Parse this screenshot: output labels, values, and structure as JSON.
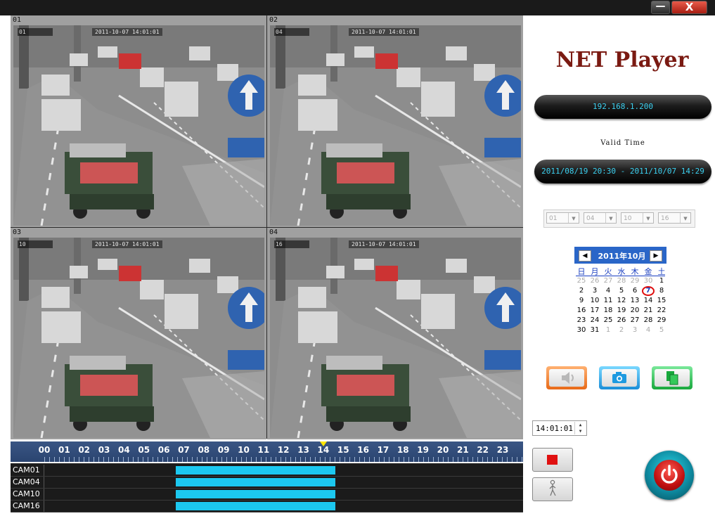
{
  "window": {
    "minimize_label": "—",
    "close_label": "X"
  },
  "video": {
    "channels": [
      {
        "label": "01",
        "osd_id": "01",
        "timestamp": "2011-10-07 14:01:01"
      },
      {
        "label": "02",
        "osd_id": "04",
        "timestamp": "2011-10-07 14:01:01"
      },
      {
        "label": "03",
        "osd_id": "10",
        "timestamp": "2011-10-07 14:01:01"
      },
      {
        "label": "04",
        "osd_id": "16",
        "timestamp": "2011-10-07 14:01:01"
      }
    ]
  },
  "timeline": {
    "hours": [
      "00",
      "01",
      "02",
      "03",
      "04",
      "05",
      "06",
      "07",
      "08",
      "09",
      "10",
      "11",
      "12",
      "13",
      "14",
      "15",
      "16",
      "17",
      "18",
      "19",
      "20",
      "21",
      "22",
      "23"
    ],
    "current_hour": 14,
    "tracks": [
      {
        "label": "CAM01",
        "start_hour": 6.6,
        "end_hour": 14.6
      },
      {
        "label": "CAM04",
        "start_hour": 6.6,
        "end_hour": 14.6
      },
      {
        "label": "CAM10",
        "start_hour": 6.6,
        "end_hour": 14.6
      },
      {
        "label": "CAM16",
        "start_hour": 6.6,
        "end_hour": 14.6
      }
    ],
    "record_color": "#1cc8f0"
  },
  "sidebar": {
    "title": "NET Player",
    "ip": "192.168.1.200",
    "valid_label": "Valid Time",
    "valid_range": "2011/08/19 20:30 - 2011/10/07 14:29",
    "channel_selects": [
      "01",
      "04",
      "10",
      "16"
    ]
  },
  "calendar": {
    "month_label": "2011年10月",
    "prev_icon": "◀",
    "next_icon": "▶",
    "weekdays": [
      "日",
      "月",
      "火",
      "水",
      "木",
      "金",
      "土"
    ],
    "weeks": [
      [
        "25",
        "26",
        "27",
        "28",
        "29",
        "30",
        "1"
      ],
      [
        "2",
        "3",
        "4",
        "5",
        "6",
        "7",
        "8"
      ],
      [
        "9",
        "10",
        "11",
        "12",
        "13",
        "14",
        "15"
      ],
      [
        "16",
        "17",
        "18",
        "19",
        "20",
        "21",
        "22"
      ],
      [
        "23",
        "24",
        "25",
        "26",
        "27",
        "28",
        "29"
      ],
      [
        "30",
        "31",
        "1",
        "2",
        "3",
        "4",
        "5"
      ]
    ],
    "selected_day": "7"
  },
  "controls": {
    "time_value": "14:01:01",
    "icons": [
      "speaker-icon",
      "camera-icon",
      "copy-icon",
      "stop-icon",
      "walking-person-icon",
      "power-icon"
    ]
  }
}
